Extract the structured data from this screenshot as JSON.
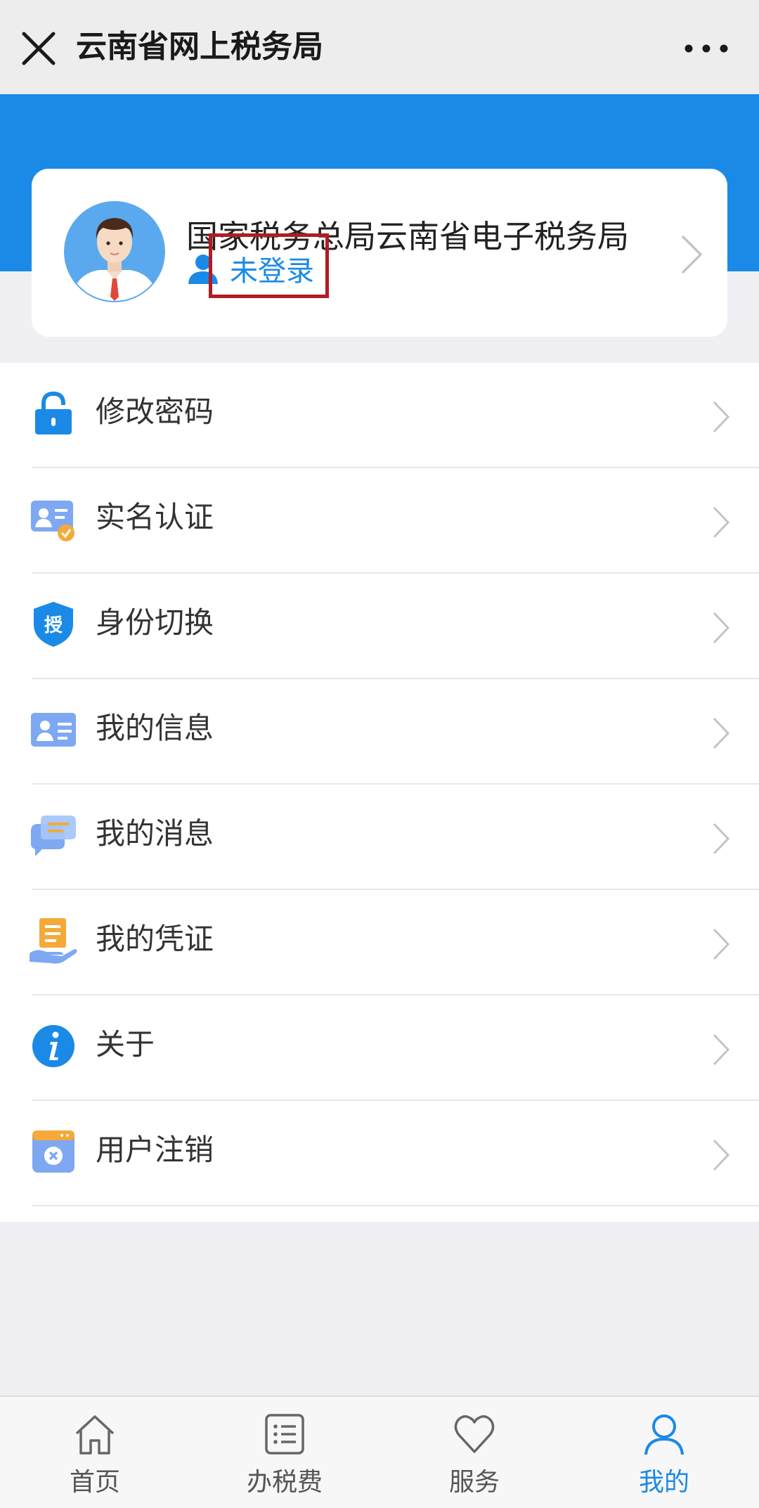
{
  "navbar": {
    "title": "云南省网上税务局",
    "close_icon": "close-icon",
    "more_icon": "more-horizontal-icon"
  },
  "profile": {
    "org_name": "国家税务总局云南省电子税务局",
    "login_status": "未登录",
    "highlight_color": "#b01c22"
  },
  "menu": {
    "items": [
      {
        "label": "修改密码",
        "icon": "lock-icon"
      },
      {
        "label": "实名认证",
        "icon": "id-verify-icon"
      },
      {
        "label": "身份切换",
        "icon": "authorize-shield-icon"
      },
      {
        "label": "我的信息",
        "icon": "info-card-icon"
      },
      {
        "label": "我的消息",
        "icon": "message-bubble-icon"
      },
      {
        "label": "我的凭证",
        "icon": "voucher-hand-icon"
      },
      {
        "label": "关于",
        "icon": "about-info-icon"
      },
      {
        "label": "用户注销",
        "icon": "cancel-account-icon"
      }
    ],
    "authorize_badge": "授"
  },
  "tabbar": {
    "tabs": [
      {
        "label": "首页",
        "icon": "home-icon",
        "active": false
      },
      {
        "label": "办税费",
        "icon": "list-icon",
        "active": false
      },
      {
        "label": "服务",
        "icon": "heart-icon",
        "active": false
      },
      {
        "label": "我的",
        "icon": "user-icon",
        "active": true
      }
    ]
  },
  "colors": {
    "accent": "#1a8ae6",
    "background": "#efeff4",
    "highlight": "#b01c22"
  }
}
